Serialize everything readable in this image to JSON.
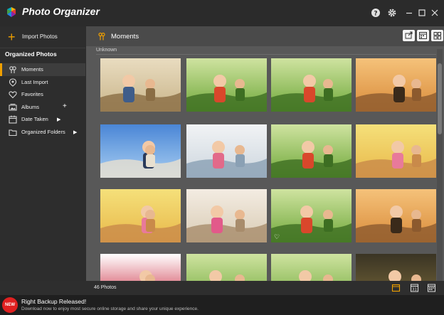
{
  "app": {
    "title": "Photo Organizer"
  },
  "titlebar": {
    "help_icon": "help-icon",
    "settings_icon": "gear-icon",
    "minimize_icon": "minimize-icon",
    "maximize_icon": "maximize-icon",
    "close_icon": "close-icon"
  },
  "sidebar": {
    "import_label": "Import Photos",
    "section_title": "Organized Photos",
    "items": [
      {
        "label": "Moments",
        "icon": "moments-icon",
        "active": true
      },
      {
        "label": "Last Import",
        "icon": "last-import-icon"
      },
      {
        "label": "Favorites",
        "icon": "heart-icon"
      },
      {
        "label": "Albums",
        "icon": "albums-icon"
      },
      {
        "label": "Date Taken",
        "icon": "calendar-icon"
      },
      {
        "label": "Organized Folders",
        "icon": "folder-icon"
      }
    ]
  },
  "main": {
    "title": "Moments",
    "group_label": "Unknown",
    "header_buttons": [
      "export-icon",
      "calendar-view-icon",
      "grid-view-icon"
    ]
  },
  "photos": [
    {
      "name": "kids-with-rake",
      "scene": "sand",
      "favorite": false
    },
    {
      "name": "boy-in-grass",
      "scene": "grass",
      "favorite": false
    },
    {
      "name": "family-camping",
      "scene": "grass",
      "favorite": false
    },
    {
      "name": "father-son-bike",
      "scene": "sunset",
      "favorite": false
    },
    {
      "name": "friends-selfie",
      "scene": "sky",
      "favorite": false
    },
    {
      "name": "girl-on-stairs",
      "scene": "white",
      "favorite": false
    },
    {
      "name": "boy-magnifier",
      "scene": "grass",
      "favorite": false
    },
    {
      "name": "mother-daughter-blossom",
      "scene": "yellow",
      "favorite": false
    },
    {
      "name": "mother-daughter-flowers",
      "scene": "yellow",
      "favorite": false
    },
    {
      "name": "girl-balloons-pier",
      "scene": "pale",
      "favorite": false
    },
    {
      "name": "girl-with-flag",
      "scene": "grass",
      "favorite": true
    },
    {
      "name": "lake-sunset",
      "scene": "sunset",
      "favorite": false
    },
    {
      "name": "group-with-flag",
      "scene": "flag",
      "favorite": false
    },
    {
      "name": "woman-in-field",
      "scene": "grass",
      "favorite": false
    },
    {
      "name": "kids-playing-park",
      "scene": "grass",
      "favorite": false
    },
    {
      "name": "evening-forest",
      "scene": "dark",
      "favorite": false
    }
  ],
  "status": {
    "count_text": "46 Photos"
  },
  "promo": {
    "badge": "NEW",
    "title": "Right Backup Released!",
    "subtitle": "Download now to enjoy most secure online storage and share your unique experience."
  },
  "colors": {
    "accent": "#f0a000",
    "sidebar_bg": "#2d2d2d",
    "content_bg": "#585858",
    "promo_bg": "#1f1f1f"
  }
}
